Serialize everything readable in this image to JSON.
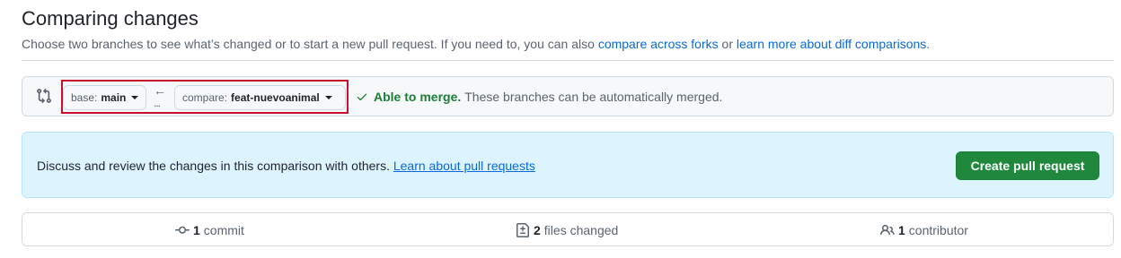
{
  "header": {
    "title": "Comparing changes",
    "subtitle_text": "Choose two branches to see what’s changed or to start a new pull request. If you need to, you can also ",
    "link_compare_forks": "compare across forks",
    "subtitle_or": " or ",
    "link_diff_comparisons": "learn more about diff comparisons",
    "subtitle_end": "."
  },
  "range": {
    "base_prefix": "base:",
    "base_branch": "main",
    "compare_prefix": "compare:",
    "compare_branch": "feat-nuevoanimal",
    "arrow": "←",
    "dots": "...",
    "merge_ok": "Able to merge.",
    "merge_desc": "These branches can be automatically merged."
  },
  "banner": {
    "text": "Discuss and review the changes in this comparison with others. ",
    "link": "Learn about pull requests",
    "button": "Create pull request"
  },
  "summary": {
    "commits_count": "1",
    "commits_label": "commit",
    "files_count": "2",
    "files_label": "files changed",
    "contributors_count": "1",
    "contributors_label": "contributor"
  },
  "colors": {
    "accent_link": "#0969da",
    "success": "#1a7f37",
    "primary_button": "#1f883d",
    "banner_bg": "#ddf4ff",
    "highlight": "#c8102e"
  },
  "icons": [
    "git-compare-icon",
    "caret-down-icon",
    "arrow-left-icon",
    "check-icon",
    "git-commit-icon",
    "file-diff-icon",
    "people-icon"
  ]
}
